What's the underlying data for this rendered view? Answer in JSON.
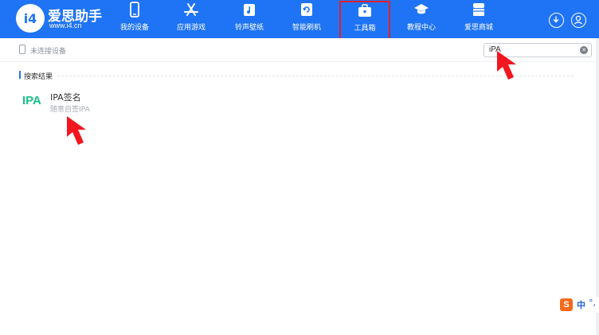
{
  "app": {
    "logo_mark": "i4",
    "name": "爱思助手",
    "url": "www.i4.cn"
  },
  "nav": [
    {
      "label": "我的设备",
      "icon": "phone-icon"
    },
    {
      "label": "应用游戏",
      "icon": "app-store-icon"
    },
    {
      "label": "铃声壁纸",
      "icon": "music-wallpaper-icon"
    },
    {
      "label": "智能刷机",
      "icon": "flash-icon"
    },
    {
      "label": "工具箱",
      "icon": "toolbox-icon",
      "active": true
    },
    {
      "label": "教程中心",
      "icon": "graduation-cap-icon"
    },
    {
      "label": "爱思商城",
      "icon": "store-icon"
    }
  ],
  "device_status": "未连接设备",
  "search": {
    "value": "iPA"
  },
  "results": {
    "title": "搜索结果",
    "items": [
      {
        "icon_text": "IPA",
        "title": "IPA签名",
        "subtitle": "随意自签IPA"
      }
    ]
  },
  "ime": {
    "logo": "S",
    "mode": "中",
    "punct": "°,"
  },
  "colors": {
    "brand": "#1f74f5",
    "highlight": "#e2202a",
    "ipa_green": "#19c08a"
  }
}
